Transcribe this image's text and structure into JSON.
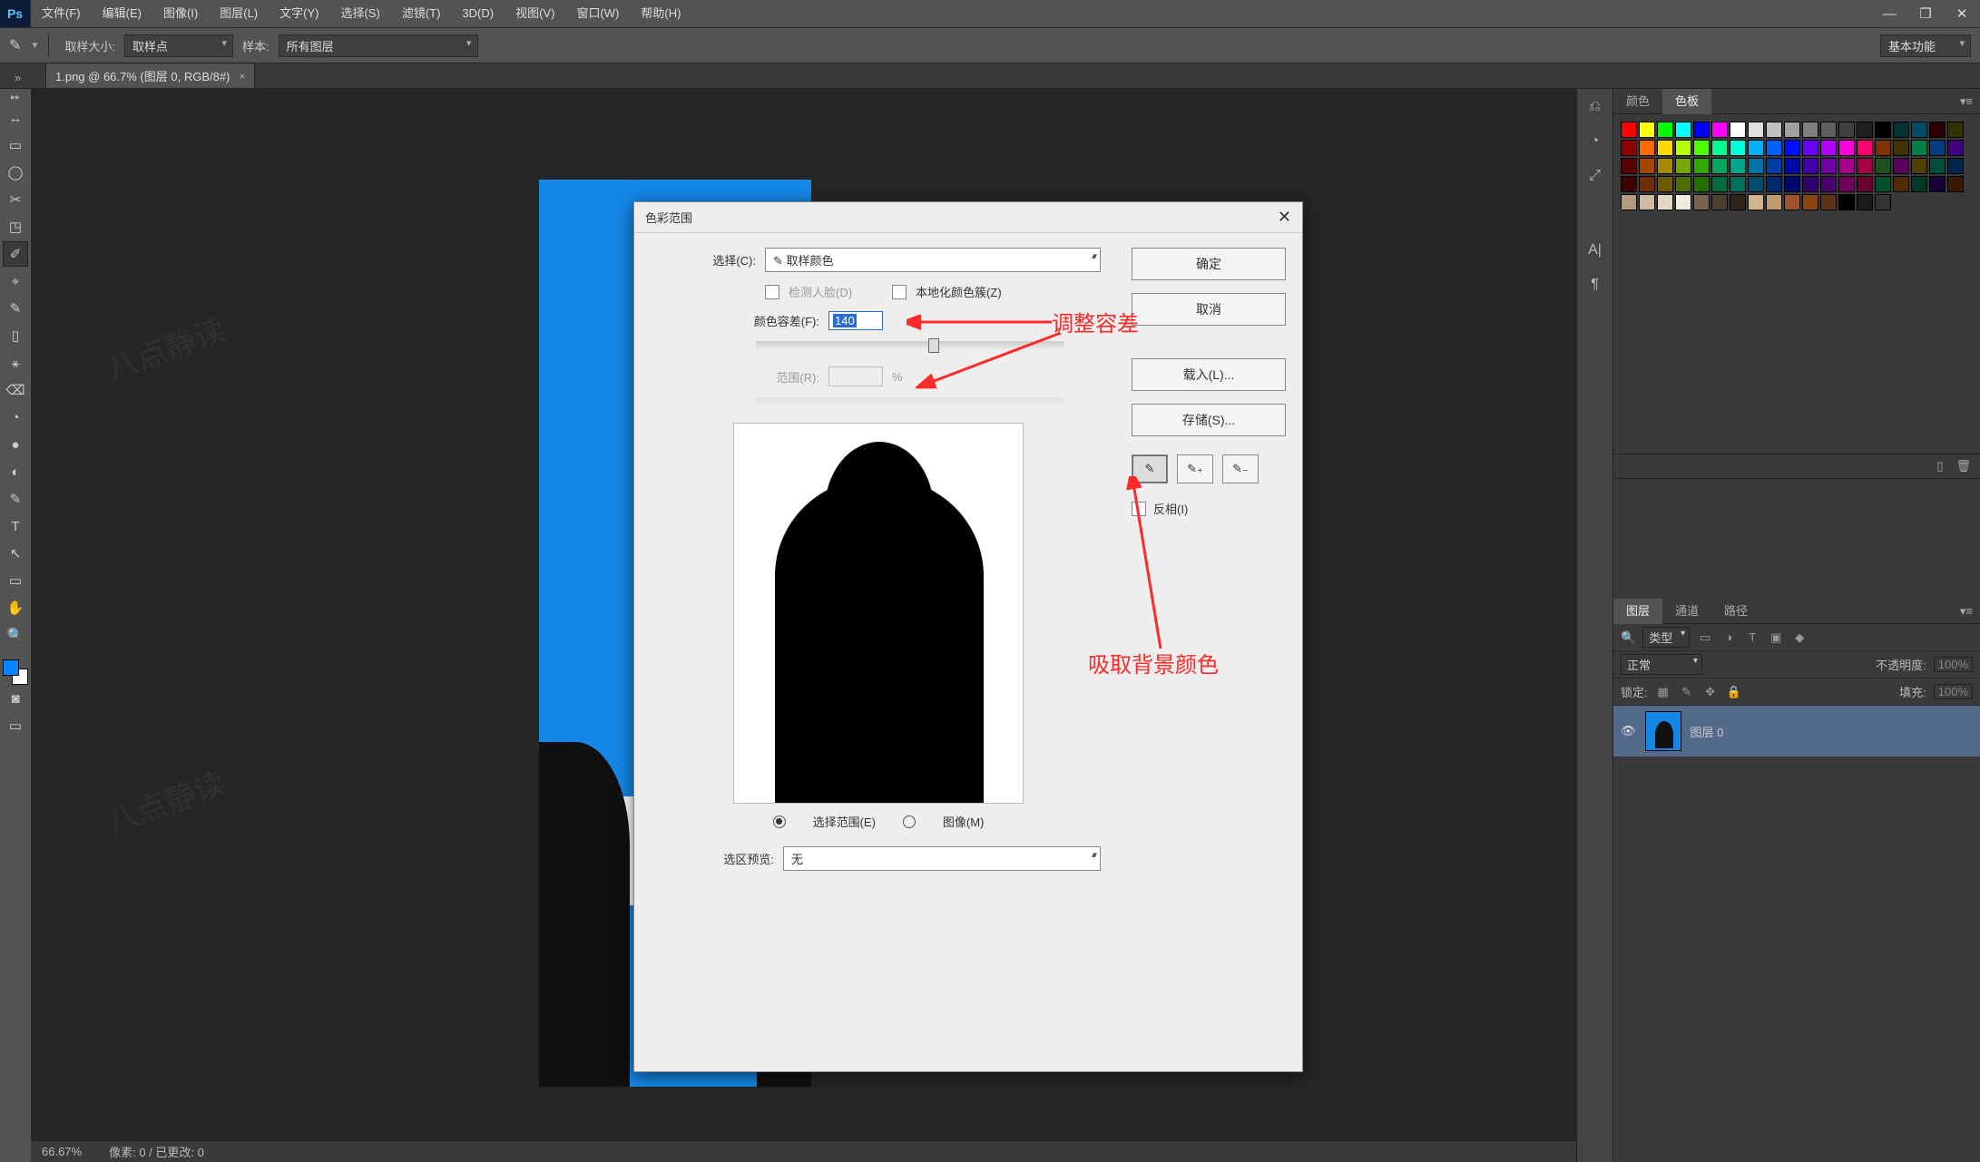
{
  "menu": {
    "items": [
      "文件(F)",
      "编辑(E)",
      "图像(I)",
      "图层(L)",
      "文字(Y)",
      "选择(S)",
      "滤镜(T)",
      "3D(D)",
      "视图(V)",
      "窗口(W)",
      "帮助(H)"
    ]
  },
  "window_buttons": {
    "min": "—",
    "max": "❐",
    "close": "✕"
  },
  "options_bar": {
    "sample_size_label": "取样大小:",
    "sample_size_value": "取样点",
    "sample_label": "样本:",
    "sample_value": "所有图层",
    "workspace": "基本功能"
  },
  "document_tab": {
    "title": "1.png @ 66.7% (图层 0, RGB/8#)",
    "close": "×"
  },
  "tools": [
    "↔",
    "▭",
    "◯",
    "✂",
    "✎",
    "◳",
    "✥",
    "✐",
    "⌖",
    "✧",
    "✎",
    "▯",
    "⚹",
    "⌫",
    "◔",
    "●",
    "◐",
    "✎",
    "T",
    "↖",
    "▭",
    "✋",
    "🔍"
  ],
  "right_icons": [
    "⎌",
    "◔",
    "⤢",
    "A|",
    "¶"
  ],
  "swatch_tabs": {
    "color": "颜色",
    "swatches": "色板"
  },
  "swatch_colors": [
    "#ff0000",
    "#ffff00",
    "#00ff00",
    "#00ffff",
    "#0000ff",
    "#ff00ff",
    "#ffffff",
    "#e0e0e0",
    "#c0c0c0",
    "#a0a0a0",
    "#808080",
    "#606060",
    "#404040",
    "#202020",
    "#000000",
    "#003333",
    "#004c66",
    "#2c0000",
    "#333300",
    "#8e0000",
    "#ff6a00",
    "#ffd800",
    "#b6ff00",
    "#4cff00",
    "#00ff90",
    "#00ffd8",
    "#00b0ff",
    "#0060ff",
    "#0010ff",
    "#6a00ff",
    "#b200ff",
    "#ff00dc",
    "#ff006e",
    "#7f3300",
    "#403300",
    "#007f46",
    "#003f7f",
    "#40007f",
    "#590000",
    "#a64500",
    "#a68b00",
    "#76a600",
    "#33a600",
    "#00a65d",
    "#00a68c",
    "#0073a6",
    "#003ea6",
    "#000aa6",
    "#4400a6",
    "#7300a6",
    "#a6008f",
    "#a60047",
    "#205020",
    "#5c005c",
    "#4d4000",
    "#004d3f",
    "#00264d",
    "#3c0000",
    "#6e2e00",
    "#6e5c00",
    "#4e6e00",
    "#226e00",
    "#006e3e",
    "#006e5d",
    "#004c6e",
    "#00296e",
    "#00076e",
    "#2d006e",
    "#4c006e",
    "#6e005e",
    "#6e002f",
    "#00502a",
    "#502a00",
    "#003828",
    "#1a0038",
    "#381a00",
    "#b59a7a",
    "#cdbaa0",
    "#e3d7c4",
    "#f1ebe0",
    "#786450",
    "#4e4030",
    "#2e2518",
    "#d2b48c",
    "#c19a6b",
    "#a0522d",
    "#8b4513",
    "#5c3317",
    "#000000",
    "#1a1a1a",
    "#333333"
  ],
  "layers_panel": {
    "tabs": {
      "layers": "图层",
      "channels": "通道",
      "paths": "路径"
    },
    "kind_label": "类型",
    "blend_mode": "正常",
    "opacity_label": "不透明度:",
    "opacity_value": "100%",
    "lock_label": "锁定:",
    "fill_label": "填充:",
    "fill_value": "100%",
    "filter_icons": [
      "▭",
      "◑",
      "T",
      "▣",
      "◆"
    ],
    "lock_icons": [
      "▦",
      "✎",
      "✥",
      "🔒"
    ],
    "layer_name": "图层 0"
  },
  "dialog": {
    "title": "色彩范围",
    "select_label": "选择(C):",
    "select_value": "✎ 取样颜色",
    "detect_faces": "检测人脸(D)",
    "localized": "本地化颜色簇(Z)",
    "fuzziness_label": "颜色容差(F):",
    "fuzziness_value": "140",
    "range_label": "范围(R):",
    "range_unit": "%",
    "radio_selection": "选择范围(E)",
    "radio_image": "图像(M)",
    "preview_label": "选区预览:",
    "preview_value": "无",
    "btn_ok": "确定",
    "btn_cancel": "取消",
    "btn_load": "载入(L)...",
    "btn_save": "存储(S)...",
    "invert": "反相(I)",
    "close": "✕"
  },
  "annotations": {
    "tolerance": "调整容差",
    "pick_bg": "吸取背景颜色"
  },
  "status": {
    "zoom": "66.67%",
    "info": "像素: 0 / 已更改: 0"
  },
  "watermark": "八点静读"
}
